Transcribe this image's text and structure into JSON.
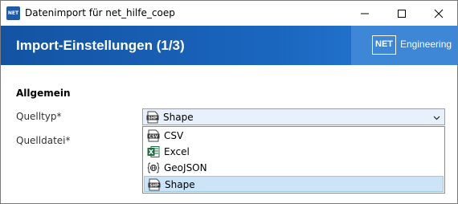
{
  "window": {
    "title": "Datenimport für net_hilfe_coep",
    "app_icon_text": "NET"
  },
  "banner": {
    "title": "Import-Einstellungen (1/3)",
    "brand_box": "NET",
    "brand_text": "Engineering"
  },
  "section": {
    "title": "Allgemein"
  },
  "fields": {
    "source_type_label": "Quelltyp*",
    "source_file_label": "Quelldatei*"
  },
  "combo": {
    "selected": "Shape",
    "options": [
      {
        "label": "CSV",
        "icon": "csv-file-icon"
      },
      {
        "label": "Excel",
        "icon": "excel-icon"
      },
      {
        "label": "GeoJSON",
        "icon": "geojson-icon"
      },
      {
        "label": "Shape",
        "icon": "shape-file-icon",
        "selected": true
      }
    ]
  },
  "colors": {
    "banner": "#1a66bf",
    "brand_panel": "#3e86d6",
    "selection": "#cce4f7",
    "combo_border": "#7aa7d8"
  }
}
